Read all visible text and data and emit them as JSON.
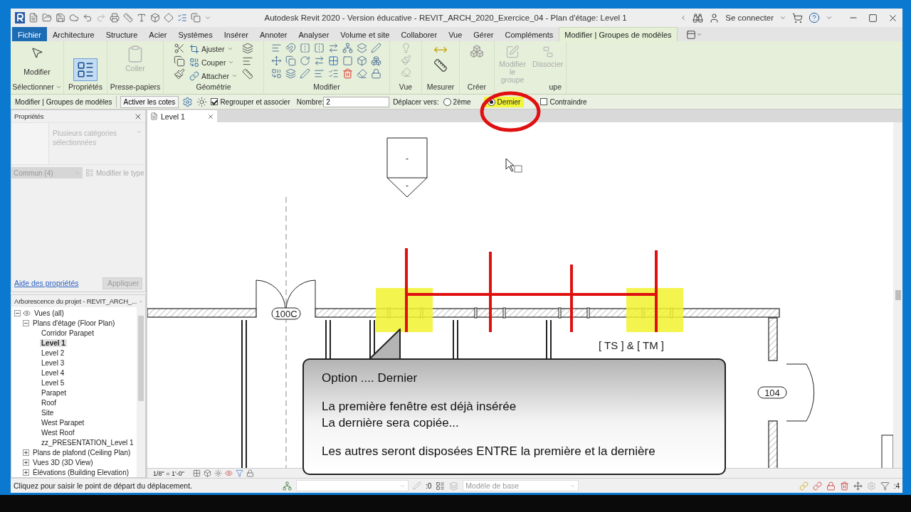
{
  "title_bar": {
    "title": "Autodesk Revit 2020 - Version éducative - REVIT_ARCH_2020_Exercice_04 - Plan d'étage: Level 1",
    "sign_in": "Se connecter"
  },
  "ribbon_tabs": [
    {
      "label": "Fichier",
      "kind": "file",
      "selected": false
    },
    {
      "label": "Architecture",
      "kind": "tab",
      "selected": false
    },
    {
      "label": "Structure",
      "kind": "tab",
      "selected": false
    },
    {
      "label": "Acier",
      "kind": "tab",
      "selected": false
    },
    {
      "label": "Systèmes",
      "kind": "tab",
      "selected": false
    },
    {
      "label": "Insérer",
      "kind": "tab",
      "selected": false
    },
    {
      "label": "Annoter",
      "kind": "tab",
      "selected": false
    },
    {
      "label": "Analyser",
      "kind": "tab",
      "selected": false
    },
    {
      "label": "Volume et site",
      "kind": "tab",
      "selected": false
    },
    {
      "label": "Collaborer",
      "kind": "tab",
      "selected": false
    },
    {
      "label": "Vue",
      "kind": "tab",
      "selected": false
    },
    {
      "label": "Gérer",
      "kind": "tab",
      "selected": false
    },
    {
      "label": "Compléments",
      "kind": "tab",
      "selected": false
    },
    {
      "label": "Modifier | Groupes de modèles",
      "kind": "context",
      "selected": true
    }
  ],
  "ribbon_groups": [
    {
      "kind": "select",
      "label": "Sélectionner",
      "buttons": [
        {
          "label": "Modifier",
          "disabled": false
        }
      ]
    },
    {
      "kind": "properties",
      "label": "Propriétés"
    },
    {
      "kind": "clipboard",
      "label": "Presse-papiers",
      "buttons": [
        {
          "label": "Coller",
          "disabled": true
        }
      ]
    },
    {
      "kind": "geometry",
      "label": "Géométrie",
      "buttons": [
        {
          "label": "Ajuster",
          "disabled": false
        },
        {
          "label": "Couper",
          "disabled": false
        },
        {
          "label": "Attacher",
          "disabled": false
        }
      ]
    },
    {
      "kind": "modify",
      "label": "Modifier"
    },
    {
      "kind": "view",
      "label": "Vue"
    },
    {
      "kind": "measure",
      "label": "Mesurer"
    },
    {
      "kind": "create",
      "label": "Créer"
    },
    {
      "kind": "group",
      "label": "upe",
      "buttons": [
        {
          "label": "Modifier le groupe",
          "disabled": true
        },
        {
          "label": "Dissocier",
          "disabled": true
        }
      ]
    }
  ],
  "options_bar": {
    "context": "Modifier | Groupes de modèles",
    "dimensions_button": "Activer les cotes",
    "group_checkbox": {
      "label": "Regrouper et associer",
      "checked": true
    },
    "count_label": "Nombre:",
    "count_value": "2",
    "move_label": "Déplacer vers:",
    "move_options": [
      {
        "label": "2ème",
        "selected": false,
        "highlighted": false
      },
      {
        "label": "Dernier",
        "selected": true,
        "highlighted": true
      }
    ],
    "constrain_checkbox": {
      "label": "Contraindre",
      "checked": false
    }
  },
  "properties": {
    "title": "Propriétés",
    "type": "Plusieurs catégories sélectionnées",
    "filter": "Commun (4)",
    "edit_type": "Modifier le type",
    "help_link": "Aide des propriétés",
    "apply": "Appliquer"
  },
  "project_browser": {
    "title": "Arborescence du projet - REVIT_ARCH_...",
    "tree": [
      {
        "label": "Vues (all)",
        "expanded": true,
        "selected": false,
        "children": [
          {
            "label": "Plans d'étage (Floor Plan)",
            "expanded": true,
            "selected": false,
            "children": [
              {
                "label": "Corridor Parapet",
                "selected": false
              },
              {
                "label": "Level 1",
                "selected": true
              },
              {
                "label": "Level 2",
                "selected": false
              },
              {
                "label": "Level 3",
                "selected": false
              },
              {
                "label": "Level 4",
                "selected": false
              },
              {
                "label": "Level 5",
                "selected": false
              },
              {
                "label": "Parapet",
                "selected": false
              },
              {
                "label": "Roof",
                "selected": false
              },
              {
                "label": "Site",
                "selected": false
              },
              {
                "label": "West Parapet",
                "selected": false
              },
              {
                "label": "West Roof",
                "selected": false
              },
              {
                "label": "zz_PRESENTATION_Level 1",
                "selected": false
              }
            ]
          },
          {
            "label": "Plans de plafond (Ceiling Plan)",
            "expanded": false,
            "selected": false
          },
          {
            "label": "Vues 3D (3D View)",
            "expanded": false,
            "selected": false
          },
          {
            "label": "Élévations (Building Elevation)",
            "expanded": false,
            "selected": false
          }
        ]
      }
    ]
  },
  "view_tab": {
    "label": "Level 1"
  },
  "canvas": {
    "view_tag": [
      "-",
      "-"
    ],
    "door_tags": [
      "100C",
      "104"
    ],
    "tag_label": "[ TS ] & [ TM ]",
    "callout": [
      [
        "Option .... Dernier"
      ],
      [
        "La première fenêtre est déjà insérée",
        "La dernière sera copiée..."
      ],
      [
        "Les autres seront disposées ENTRE la première et la dernière"
      ]
    ]
  },
  "view_bar": {
    "scale": "1/8\" = 1'-0\""
  },
  "status_bar": {
    "message": "Cliquez pour saisir le point de départ du déplacement.",
    "count": ":0",
    "model": "Modèle de base",
    "filter_count": ":4"
  }
}
